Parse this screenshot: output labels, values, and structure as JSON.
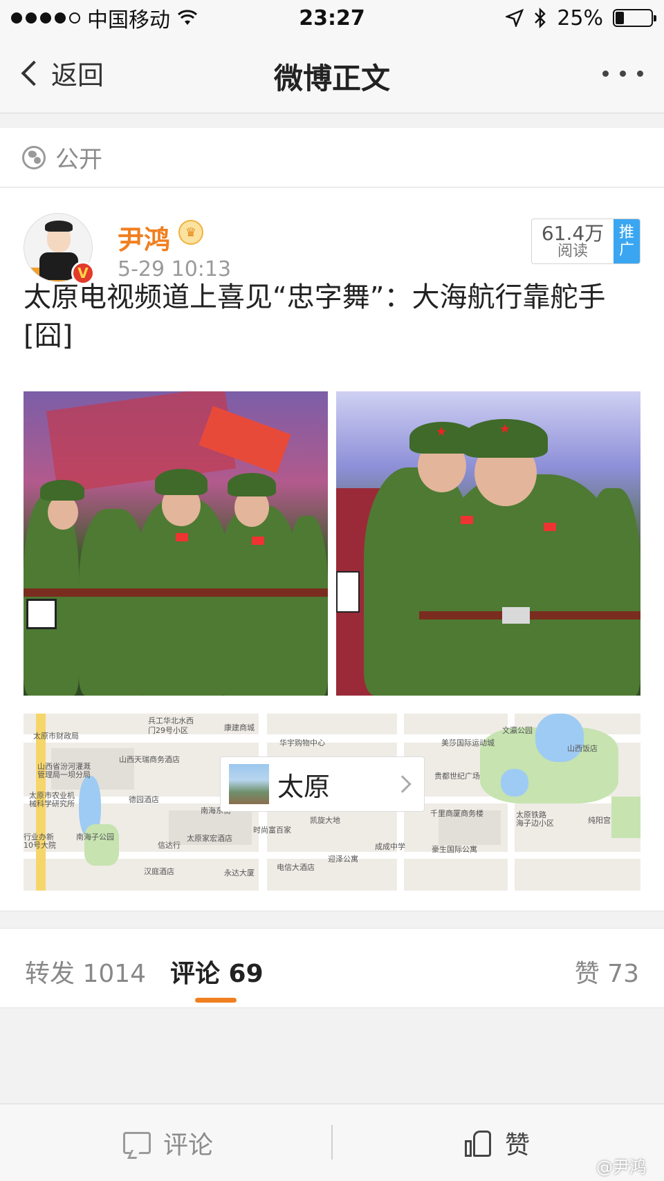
{
  "status_bar": {
    "carrier": "中国移动",
    "time": "23:27",
    "battery": "25%"
  },
  "nav": {
    "back_label": "返回",
    "title": "微博正文"
  },
  "privacy": {
    "label": "公开",
    "icon": "globe-icon"
  },
  "post": {
    "author": "尹鸿",
    "verified_badge": "V",
    "time": "5-29 10:13",
    "reads": "61.4万",
    "reads_label": "阅读",
    "promote_label": [
      "推",
      "广"
    ],
    "text": "太原电视频道上喜见“忠字舞”：大海航行靠舵手[囧]",
    "images": [
      "dance-photo-1",
      "dance-photo-2"
    ],
    "location": {
      "city": "太原",
      "map_labels": [
        "兵工华北水西",
        "门29号小区",
        "太原市财政局",
        "康建商城",
        "华宇购物中心",
        "美莎国际运动城",
        "文瀛公园",
        "山西天瑞商务酒店",
        "山西饭店",
        "山西省汾河灌溉",
        "管理局一坝分局",
        "贵都世纪广场",
        "太原市农业机",
        "械科学研究所",
        "德园酒店",
        "南海东街",
        "千里商厦商务楼",
        "太原铁路",
        "海子边小区",
        "凯旋大地",
        "纯阳宫",
        "时尚富百家",
        "行业办新",
        "10号大院",
        "南海子公园",
        "信达行",
        "太原家宏酒店",
        "成成中学",
        "豪生国际公寓",
        "迎泽公寓",
        "汉庭酒店",
        "永达大厦",
        "电信大酒店"
      ]
    }
  },
  "tabs": {
    "repost": "转发 1014",
    "comment": "评论 69",
    "like": "赞 73"
  },
  "bottom_bar": {
    "comment_label": "评论",
    "like_label": "赞"
  },
  "watermark": "@尹鸿",
  "colors": {
    "accent": "#f07f1f",
    "promote": "#3aa6f1"
  }
}
